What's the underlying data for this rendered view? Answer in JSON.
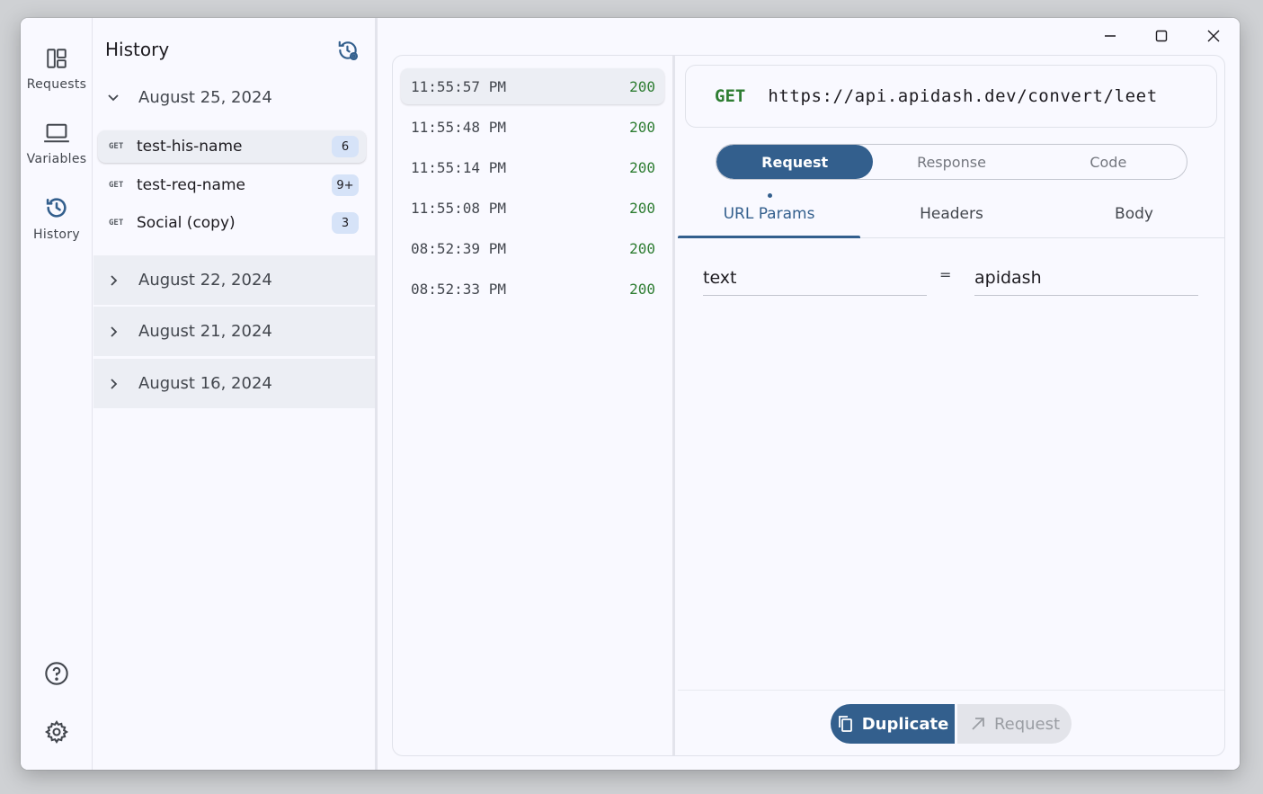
{
  "nav": {
    "requests_label": "Requests",
    "variables_label": "Variables",
    "history_label": "History"
  },
  "sidebar": {
    "title": "History",
    "open_group": {
      "date": "August 25, 2024",
      "items": [
        {
          "method": "GET",
          "name": "test-his-name",
          "count": "6"
        },
        {
          "method": "GET",
          "name": "test-req-name",
          "count": "9+"
        },
        {
          "method": "GET",
          "name": "Social (copy)",
          "count": "3"
        }
      ]
    },
    "collapsed_groups": [
      {
        "date": "August 22, 2024"
      },
      {
        "date": "August 21, 2024"
      },
      {
        "date": "August 16, 2024"
      }
    ]
  },
  "timeline": [
    {
      "time": "11:55:57 PM",
      "status": "200"
    },
    {
      "time": "11:55:48 PM",
      "status": "200"
    },
    {
      "time": "11:55:14 PM",
      "status": "200"
    },
    {
      "time": "11:55:08 PM",
      "status": "200"
    },
    {
      "time": "08:52:39 PM",
      "status": "200"
    },
    {
      "time": "08:52:33 PM",
      "status": "200"
    }
  ],
  "detail": {
    "method": "GET",
    "url": "https://api.apidash.dev/convert/leet",
    "segments": [
      "Request",
      "Response",
      "Code"
    ],
    "tabs": [
      "URL Params",
      "Headers",
      "Body"
    ],
    "param": {
      "key": "text",
      "eq": "=",
      "value": "apidash"
    },
    "duplicate_label": "Duplicate",
    "request_label": "Request"
  },
  "colors": {
    "accent": "#335f8d",
    "status_ok": "#2e7d32",
    "background": "#f9f9ff"
  }
}
